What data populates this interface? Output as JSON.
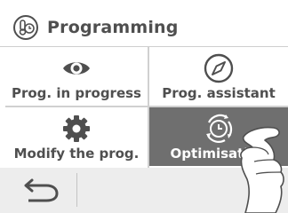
{
  "header": {
    "title": "Programming",
    "icon": "thermometer-clock-icon"
  },
  "tiles": [
    {
      "label": "Prog. in progress",
      "icon": "eye-icon",
      "selected": false
    },
    {
      "label": "Prog. assistant",
      "icon": "compass-icon",
      "selected": false
    },
    {
      "label": "Modify the prog.",
      "icon": "gear-icon",
      "selected": false
    },
    {
      "label": "Optimisation",
      "icon": "cycle-clock-icon",
      "selected": true
    }
  ],
  "footer": {
    "back_icon": "back-arrow-icon"
  },
  "colors": {
    "text": "#4f4f4f",
    "selected_tile": "#6f6f6f",
    "footer_bg": "#ededed",
    "separator": "#d0d0d0"
  }
}
